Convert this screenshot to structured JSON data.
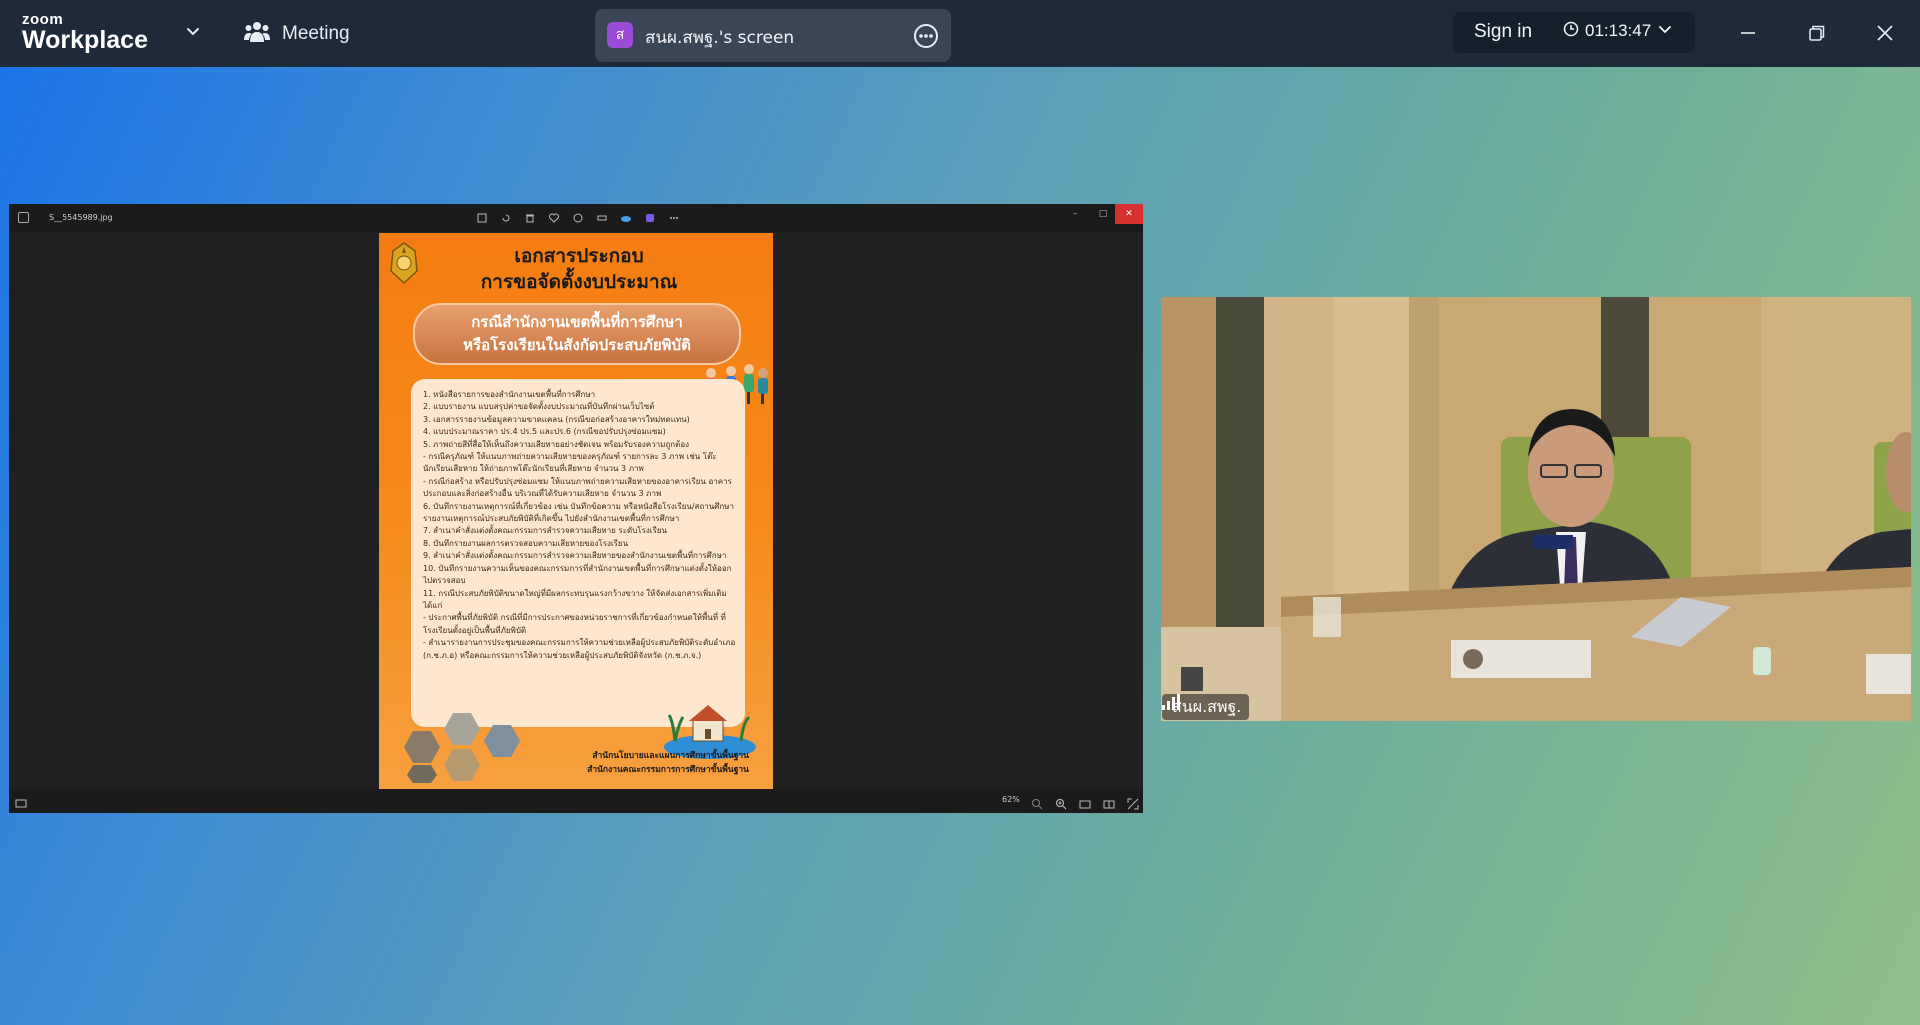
{
  "app": {
    "brand_small": "zoom",
    "brand_large": "Workplace",
    "meeting_label": "Meeting",
    "share_initial": "ส",
    "share_title": "สนผ.สพฐ.'s screen",
    "sign_in_label": "Sign in",
    "timer": "01:13:47"
  },
  "viewer": {
    "filename": "S__5545989.jpg",
    "zoom_level": "62%"
  },
  "poster": {
    "title_line1": "เอกสารประกอบ",
    "title_line2": "การขอจัดตั้งงบประมาณ",
    "banner_line1": "กรณีสำนักงานเขตพื้นที่การศึกษา",
    "banner_line2": "หรือโรงเรียนในสังกัดประสบภัยพิบัติ",
    "items": [
      "1. หนังสือรายการของสำนักงานเขตพื้นที่การศึกษา",
      "2. แบบรายงาน แบบสรุปค่าขอจัดตั้งงบประมาณที่บันทึกผ่านเว็บไซต์",
      "3. เอกสารรายงานข้อมูลความขาดแคลน (กรณีขอก่อสร้างอาคารใหม่ทดแทน)",
      "4. แบบประมาณราคา ปร.4 ปร.5 และปร.6 (กรณีขอปรับปรุงซ่อมแซม)",
      "5. ภาพถ่ายสีที่สื่อให้เห็นถึงความเสียหายอย่างชัดเจน พร้อมรับรองความถูกต้อง",
      "- กรณีครุภัณฑ์ ให้แนบภาพถ่ายความเสียหายของครุภัณฑ์ รายการละ 3 ภาพ เช่น โต๊ะนักเรียนเสียหาย ให้ถ่ายภาพโต๊ะนักเรียนที่เสียหาย จำนวน 3 ภาพ",
      "- กรณีก่อสร้าง หรือปรับปรุงซ่อมแซม ให้แนบภาพถ่ายความเสียหายของอาคารเรียน อาคารประกอบและสิ่งก่อสร้างอื่น บริเวณที่ได้รับความเสียหาย จำนวน 3 ภาพ",
      "6. บันทึกรายงานเหตุการณ์ที่เกี่ยวข้อง เช่น บันทึกข้อความ หรือหนังสือโรงเรียน/สถานศึกษารายงานเหตุการณ์ประสบภัยพิบัติที่เกิดขึ้น ไปยังสำนักงานเขตพื้นที่การศึกษา",
      "7. สำเนาคำสั่งแต่งตั้งคณะกรรมการสำรวจความเสียหาย ระดับโรงเรียน",
      "8. บันทึกรายงานผลการตรวจสอบความเสียหายของโรงเรียน",
      "9. สำเนาคำสั่งแต่งตั้งคณะกรรมการสำรวจความเสียหายของสำนักงานเขตพื้นที่การศึกษา",
      "10. บันทึกรายงานความเห็นของคณะกรรมการที่สำนักงานเขตพื้นที่การศึกษาแต่งตั้งให้ออกไปตรวจสอบ",
      "11. กรณีประสบภัยพิบัติขนาดใหญ่ที่มีผลกระทบรุนแรงกว้างขวาง ให้จัดส่งเอกสารเพิ่มเติม ได้แก่",
      "- ประกาศพื้นที่ภัยพิบัติ กรณีที่มีการประกาศของหน่วยราชการที่เกี่ยวข้องกำหนดให้พื้นที่ ที่โรงเรียนตั้งอยู่เป็นพื้นที่ภัยพิบัติ",
      "- สำเนารายงานการประชุมของคณะกรรมการให้ความช่วยเหลือผู้ประสบภัยพิบัติระดับอำเภอ (ก.ช.ภ.อ) หรือคณะกรรมการให้ความช่วยเหลือผู้ประสบภัยพิบัติจังหวัด (ก.ช.ภ.จ.)"
    ],
    "footer_line1": "สำนักนโยบายและแผนการศึกษาขั้นพื้นฐาน",
    "footer_line2": "สำนักงานคณะกรรมการการศึกษาขั้นพื้นฐาน"
  },
  "video": {
    "participant_name": "สนผ.สพฐ."
  },
  "colors": {
    "topbar": "#1e2a3a",
    "share_pill": "#3a4656",
    "avatar": "#9b4bd6",
    "poster_orange": "#f57c12",
    "viewer_close": "#d82f2f"
  },
  "icons": [
    "chevron-down-icon",
    "meeting-people-icon",
    "more-icon",
    "clock-icon",
    "minimize-icon",
    "restore-icon",
    "close-icon",
    "signal-bars-icon"
  ]
}
